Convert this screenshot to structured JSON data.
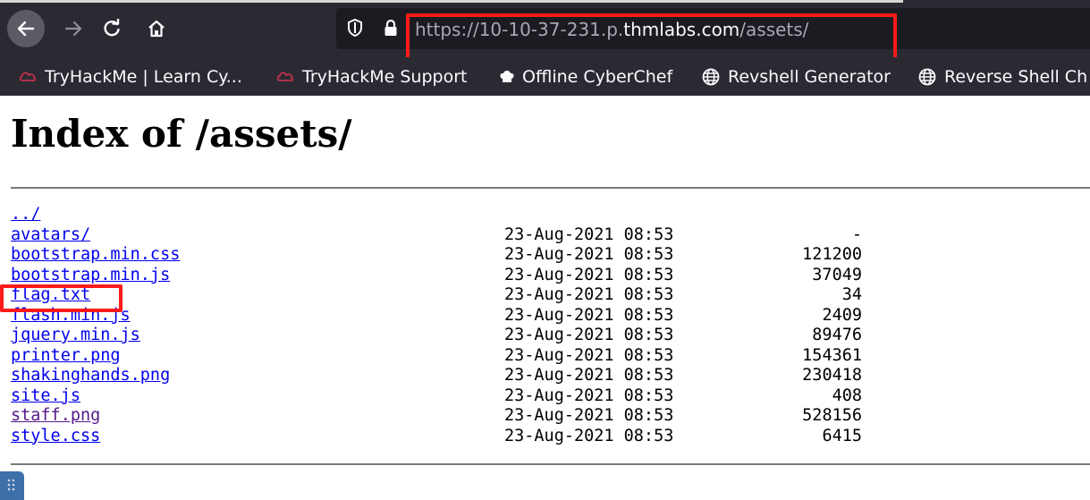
{
  "browser": {
    "url_prefix": "https://10-10-37-231.p.",
    "url_host": "thmlabs.com",
    "url_path": "/assets/"
  },
  "bookmarks": [
    {
      "label": "TryHackMe | Learn Cy...",
      "icon": "tryhackme-icon"
    },
    {
      "label": "TryHackMe Support",
      "icon": "tryhackme-icon"
    },
    {
      "label": "Offline CyberChef",
      "icon": "chef-icon"
    },
    {
      "label": "Revshell Generator",
      "icon": "globe-icon"
    },
    {
      "label": "Reverse Shell Ch",
      "icon": "globe-icon"
    }
  ],
  "page": {
    "title": "Index of /assets/",
    "parent_link": "../",
    "files": [
      {
        "name": "avatars/",
        "date": "23-Aug-2021 08:53",
        "size": "-"
      },
      {
        "name": "bootstrap.min.css",
        "date": "23-Aug-2021 08:53",
        "size": "121200"
      },
      {
        "name": "bootstrap.min.js",
        "date": "23-Aug-2021 08:53",
        "size": "37049"
      },
      {
        "name": "flag.txt",
        "date": "23-Aug-2021 08:53",
        "size": "34"
      },
      {
        "name": "flash.min.js",
        "date": "23-Aug-2021 08:53",
        "size": "2409"
      },
      {
        "name": "jquery.min.js",
        "date": "23-Aug-2021 08:53",
        "size": "89476"
      },
      {
        "name": "printer.png",
        "date": "23-Aug-2021 08:53",
        "size": "154361"
      },
      {
        "name": "shakinghands.png",
        "date": "23-Aug-2021 08:53",
        "size": "230418"
      },
      {
        "name": "site.js",
        "date": "23-Aug-2021 08:53",
        "size": "408"
      },
      {
        "name": "staff.png",
        "date": "23-Aug-2021 08:53",
        "size": "528156"
      },
      {
        "name": "style.css",
        "date": "23-Aug-2021 08:53",
        "size": "6415"
      }
    ]
  },
  "colors": {
    "toolbar_bg": "#2b2a33",
    "urlbar_bg": "#1c1b22",
    "link": "#0000ee",
    "visited_link": "#551a8b",
    "highlight_box": "#ff1a1a"
  }
}
